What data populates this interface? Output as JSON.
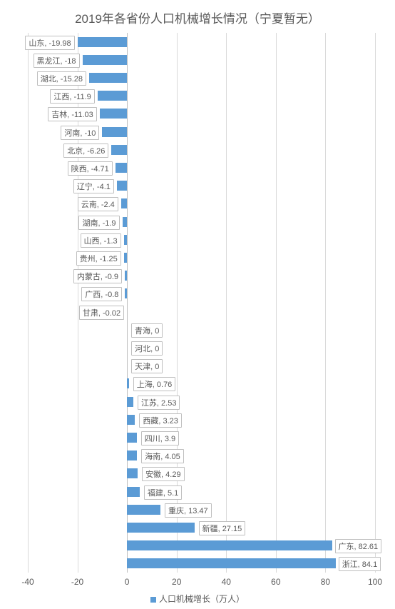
{
  "chart_data": {
    "type": "bar",
    "title": "2019年各省份人口机械增长情况（宁夏暂无）",
    "xlabel": "",
    "ylabel": "",
    "xlim": [
      -40,
      100
    ],
    "xticks": [
      -40,
      -20,
      0,
      20,
      40,
      60,
      80,
      100
    ],
    "legend": "人口机械增长（万人）",
    "series": [
      {
        "name": "人口机械增长（万人）",
        "data": [
          {
            "label": "山东",
            "value": -19.98
          },
          {
            "label": "黑龙江",
            "value": -18
          },
          {
            "label": "湖北",
            "value": -15.28
          },
          {
            "label": "江西",
            "value": -11.9
          },
          {
            "label": "吉林",
            "value": -11.03
          },
          {
            "label": "河南",
            "value": -10
          },
          {
            "label": "北京",
            "value": -6.26
          },
          {
            "label": "陕西",
            "value": -4.71
          },
          {
            "label": "辽宁",
            "value": -4.1
          },
          {
            "label": "云南",
            "value": -2.4
          },
          {
            "label": "湖南",
            "value": -1.9
          },
          {
            "label": "山西",
            "value": -1.3
          },
          {
            "label": "贵州",
            "value": -1.25
          },
          {
            "label": "内蒙古",
            "value": -0.9
          },
          {
            "label": "广西",
            "value": -0.8
          },
          {
            "label": "甘肃",
            "value": -0.02
          },
          {
            "label": "青海",
            "value": 0
          },
          {
            "label": "河北",
            "value": 0
          },
          {
            "label": "天津",
            "value": 0
          },
          {
            "label": "上海",
            "value": 0.76
          },
          {
            "label": "江苏",
            "value": 2.53
          },
          {
            "label": "西藏",
            "value": 3.23
          },
          {
            "label": "四川",
            "value": 3.9
          },
          {
            "label": "海南",
            "value": 4.05
          },
          {
            "label": "安徽",
            "value": 4.29
          },
          {
            "label": "福建",
            "value": 5.1
          },
          {
            "label": "重庆",
            "value": 13.47
          },
          {
            "label": "新疆",
            "value": 27.15
          },
          {
            "label": "广东",
            "value": 82.61
          },
          {
            "label": "浙江",
            "value": 84.1
          }
        ]
      }
    ]
  }
}
